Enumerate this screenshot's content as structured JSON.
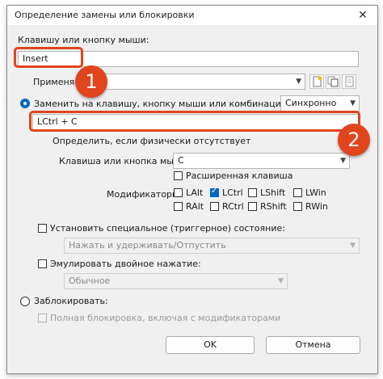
{
  "window": {
    "title": "Определение замены или блокировки"
  },
  "key_section": {
    "label": "Клавишу или кнопку мыши:",
    "value": "Insert"
  },
  "apply": {
    "label": "Применя"
  },
  "replace": {
    "radio_label": "Заменить на клавишу, кнопку мыши или комбинацию:",
    "mode_value": "Синхронно",
    "combo_value": "LCtrl + C",
    "define_label": "Определить, если физически отсутствует",
    "key_label": "Клавиша или кнопка мыши",
    "key_value": "C",
    "extended_label": "Расширенная клавиша",
    "modifiers_label": "Модификаторы",
    "modifiers": [
      {
        "label": "LAlt",
        "checked": false
      },
      {
        "label": "LCtrl",
        "checked": true
      },
      {
        "label": "LShift",
        "checked": false
      },
      {
        "label": "LWin",
        "checked": false
      },
      {
        "label": "RAlt",
        "checked": false
      },
      {
        "label": "RCtrl",
        "checked": false
      },
      {
        "label": "RShift",
        "checked": false
      },
      {
        "label": "RWin",
        "checked": false
      }
    ]
  },
  "trigger": {
    "label": "Установить специальное (триггерное) состояние:",
    "value": "Нажать и удерживать/Отпустить"
  },
  "double": {
    "label": "Эмулировать двойное нажатие:",
    "value": "Обычное"
  },
  "block": {
    "radio_label": "Заблокировать:",
    "full_label": "Полная блокировка, включая с модификаторами"
  },
  "buttons": {
    "ok": "OK",
    "cancel": "Отмена"
  },
  "annotations": [
    {
      "number": "1"
    },
    {
      "number": "2"
    }
  ],
  "colors": {
    "accent": "#0067c0",
    "highlight": "#e0451e"
  }
}
